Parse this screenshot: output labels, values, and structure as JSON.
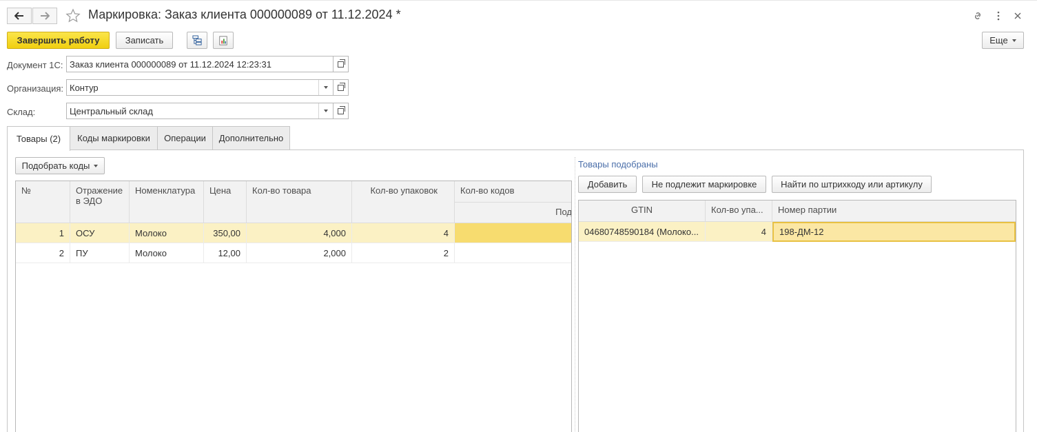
{
  "window": {
    "title": "Маркировка: Заказ клиента 000000089 от 11.12.2024 *"
  },
  "toolbar": {
    "finish_label": "Завершить работу",
    "save_label": "Записать",
    "more_label": "Еще"
  },
  "form": {
    "document_label": "Документ 1С:",
    "document_value": "Заказ клиента 000000089 от 11.12.2024 12:23:31",
    "organization_label": "Организация:",
    "organization_value": "Контур",
    "warehouse_label": "Склад:",
    "warehouse_value": "Центральный склад"
  },
  "tabs": [
    {
      "label": "Товары (2)",
      "active": true
    },
    {
      "label": "Коды маркировки",
      "active": false
    },
    {
      "label": "Операции",
      "active": false
    },
    {
      "label": "Дополнительно",
      "active": false
    }
  ],
  "left": {
    "pick_codes_label": "Подобрать коды",
    "columns": {
      "num": "№",
      "reflection_line1": "Отражение",
      "reflection_line2": "в ЭДО",
      "nomenclature": "Номенклатура",
      "price": "Цена",
      "qty_goods": "Кол-во товара",
      "qty_packs": "Кол-во упаковок",
      "qty_codes": "Кол-во кодов",
      "qty_codes_sub": "Под"
    },
    "rows": [
      {
        "num": "1",
        "reflection": "ОСУ",
        "nomenclature": "Молоко",
        "price": "350,00",
        "qty_goods": "4,000",
        "qty_packs": "4"
      },
      {
        "num": "2",
        "reflection": "ПУ",
        "nomenclature": "Молоко",
        "price": "12,00",
        "qty_goods": "2,000",
        "qty_packs": "2"
      }
    ]
  },
  "right": {
    "section_title": "Товары подобраны",
    "add_label": "Добавить",
    "not_marked_label": "Не подлежит маркировке",
    "find_label": "Найти по штрихкоду или артикулу",
    "columns": {
      "gtin": "GTIN",
      "qty_packs": "Кол-во упа...",
      "batch": "Номер партии"
    },
    "rows": [
      {
        "gtin": "04680748590184 (Молоко...",
        "qty_packs": "4",
        "batch": "198-ДМ-12"
      }
    ]
  },
  "colors": {
    "primary_button": "#f0cf10",
    "selected_row": "#fbf1c4",
    "section_title": "#4a6ea9"
  }
}
